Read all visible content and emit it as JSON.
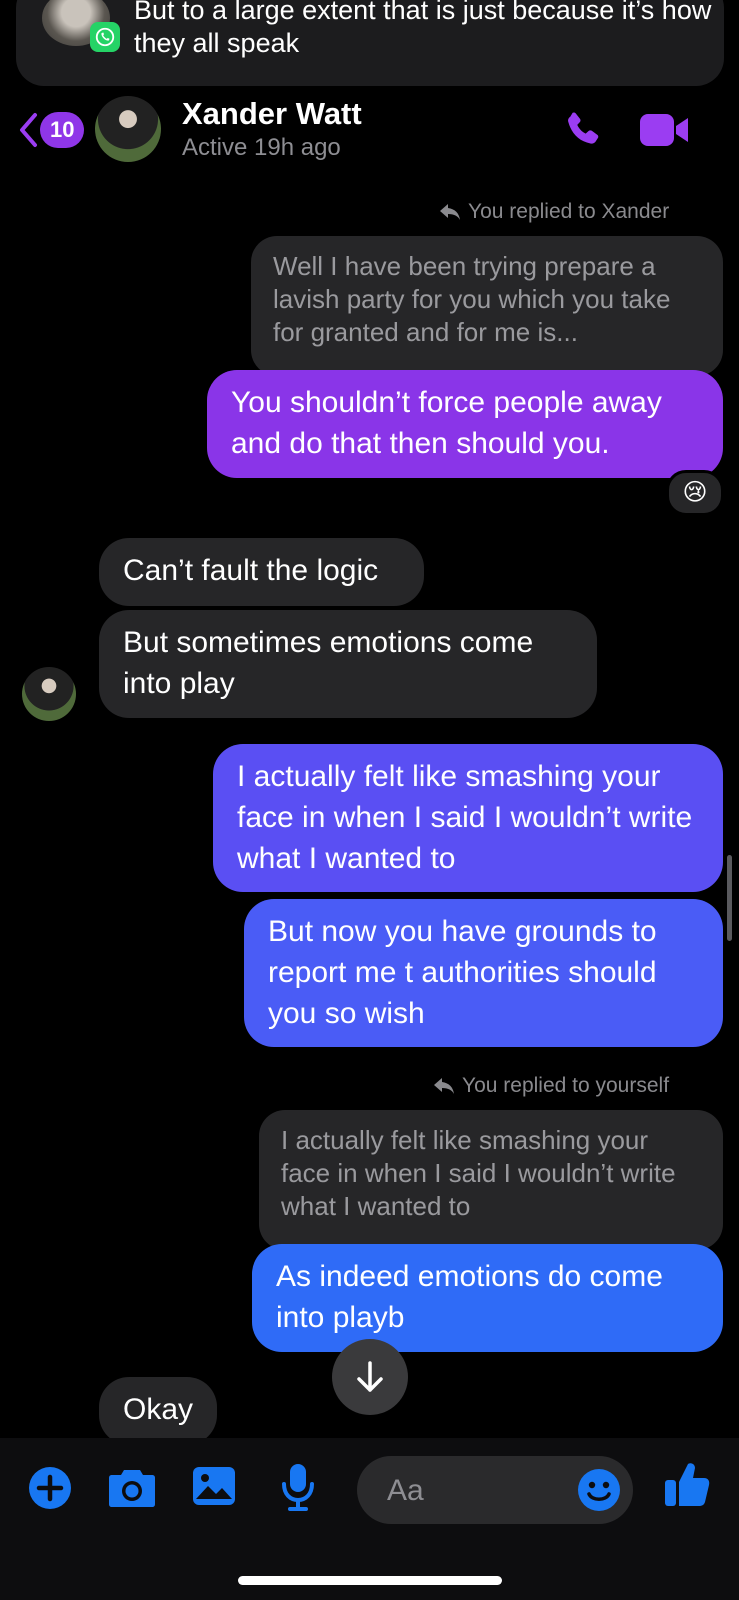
{
  "notification": {
    "text": "But to a large extent that is just because it’s how they all speak",
    "app_icon": "whatsapp-icon"
  },
  "header": {
    "back_badge": "10",
    "contact_name": "Xander Watt",
    "status": "Active 19h ago",
    "accent_color": "#9b3df2"
  },
  "messages": {
    "reply_note_1": "You replied to Xander",
    "quote_1": "Well I have been trying prepare a lavish party for you which you take for granted and for me is...",
    "sent_1": "You shouldn’t force people away and do that then should you.",
    "reaction_1": "😢",
    "received_1": "Can’t fault the logic",
    "received_2": "But sometimes emotions come into play",
    "sent_2": "I actually felt like smashing your face in when I said I wouldn’t write what I wanted to",
    "sent_3": "But now you have grounds to report me t authorities should you so wish",
    "reply_note_2": "You replied to yourself",
    "quote_2": "I actually felt like smashing your face in when I said I wouldn’t write what I wanted to",
    "sent_4": "As indeed emotions do come into playb",
    "received_3": "Okay"
  },
  "composer": {
    "placeholder": "Aa"
  },
  "colors": {
    "brand_blue": "#1877f2",
    "bubble_gradient": [
      "#8a35e8",
      "#5a4ff3",
      "#4a5cf6",
      "#2f6bf7"
    ]
  }
}
